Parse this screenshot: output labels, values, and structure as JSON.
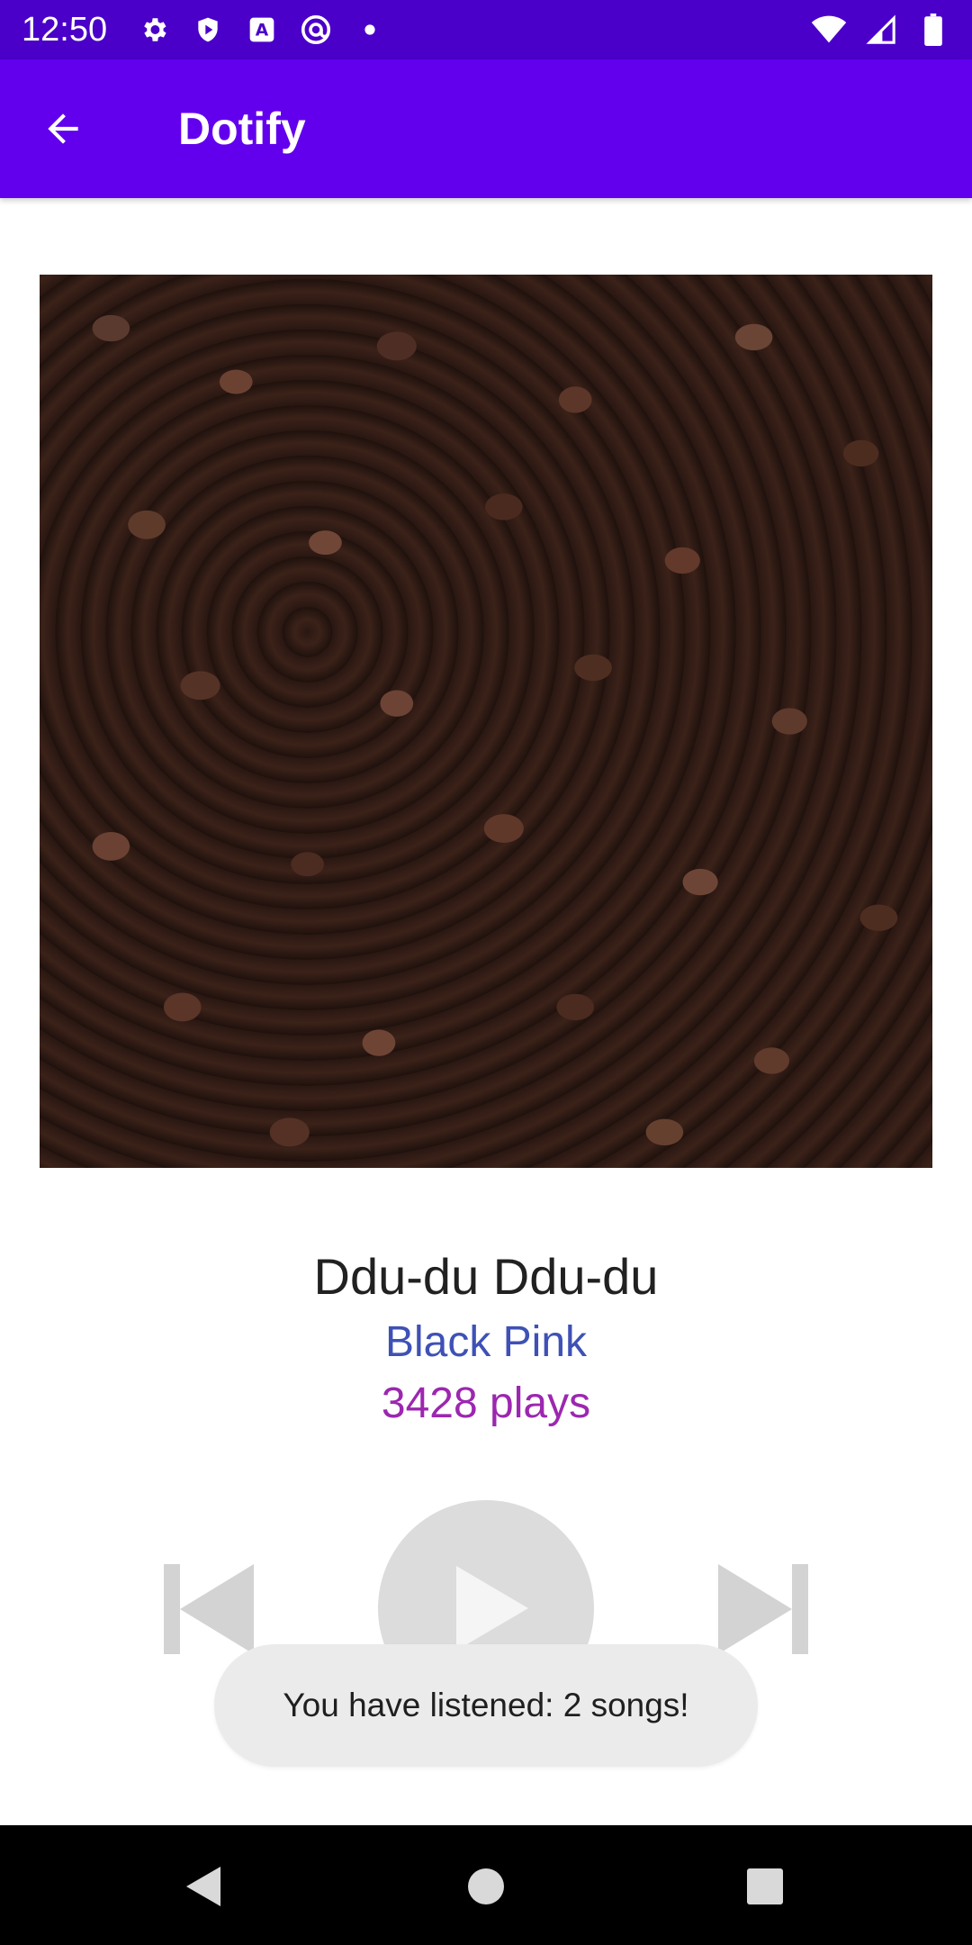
{
  "status_bar": {
    "time": "12:50",
    "icons_left": [
      "gear-icon",
      "shield-icon",
      "a-badge-icon",
      "at-icon",
      "dot-icon"
    ],
    "icons_right": [
      "wifi-icon",
      "signal-icon",
      "battery-icon"
    ],
    "background": "#4a00c9"
  },
  "app_bar": {
    "title": "Dotify",
    "back_icon": "arrow-left-icon",
    "background": "#6200ee"
  },
  "song": {
    "title": "Ddu-du Ddu-du",
    "artist": "Black Pink",
    "plays": "3428 plays",
    "album_art": "coffee-beans-image"
  },
  "controls": {
    "prev_icon": "skip-previous-icon",
    "play_icon": "play-icon",
    "next_icon": "skip-next-icon",
    "disabled_color": "#d3d3d3"
  },
  "toast": {
    "message": "You have listened: 2 songs!"
  },
  "nav_bar": {
    "icons": [
      "nav-back-icon",
      "nav-home-icon",
      "nav-recents-icon"
    ]
  },
  "colors": {
    "title_text": "#212121",
    "artist_text": "#3f51b5",
    "plays_text": "#9c27b0"
  }
}
